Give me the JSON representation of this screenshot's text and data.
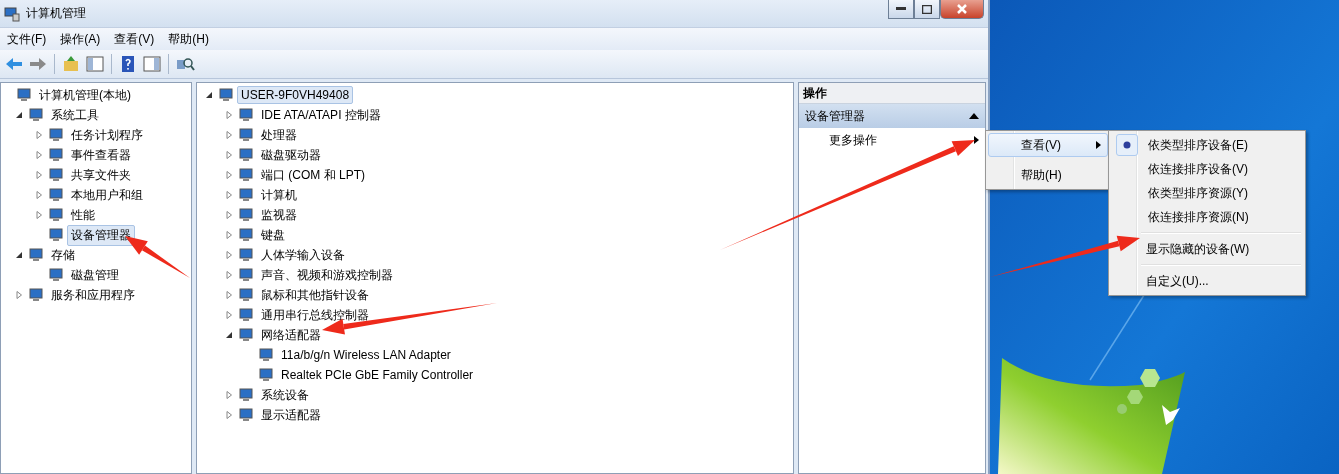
{
  "window": {
    "title": "计算机管理"
  },
  "menu_bar": [
    "文件(F)",
    "操作(A)",
    "查看(V)",
    "帮助(H)"
  ],
  "console_tree": [
    {
      "label": "计算机管理(本地)",
      "selected": false,
      "children": [
        {
          "label": "系统工具",
          "expanded": true,
          "selected": false,
          "children": [
            {
              "label": "任务计划程序",
              "expanded": false,
              "selected": false
            },
            {
              "label": "事件查看器",
              "expanded": false,
              "selected": false
            },
            {
              "label": "共享文件夹",
              "expanded": false,
              "selected": false
            },
            {
              "label": "本地用户和组",
              "expanded": false,
              "selected": false
            },
            {
              "label": "性能",
              "expanded": false,
              "selected": false
            },
            {
              "label": "设备管理器",
              "selected": true
            }
          ]
        },
        {
          "label": "存储",
          "expanded": true,
          "selected": false,
          "children": [
            {
              "label": "磁盘管理",
              "selected": false
            }
          ]
        },
        {
          "label": "服务和应用程序",
          "expanded": false,
          "selected": false
        }
      ]
    }
  ],
  "device_tree": [
    {
      "label": "USER-9F0VH49408",
      "expanded": true,
      "selected": true,
      "children": [
        {
          "label": "IDE ATA/ATAPI 控制器",
          "expanded": false,
          "selected": false
        },
        {
          "label": "处理器",
          "expanded": false,
          "selected": false
        },
        {
          "label": "磁盘驱动器",
          "expanded": false,
          "selected": false
        },
        {
          "label": "端口 (COM 和 LPT)",
          "expanded": false,
          "selected": false
        },
        {
          "label": "计算机",
          "expanded": false,
          "selected": false
        },
        {
          "label": "监视器",
          "expanded": false,
          "selected": false
        },
        {
          "label": "键盘",
          "expanded": false,
          "selected": false
        },
        {
          "label": "人体学输入设备",
          "expanded": false,
          "selected": false
        },
        {
          "label": "声音、视频和游戏控制器",
          "expanded": false,
          "selected": false
        },
        {
          "label": "鼠标和其他指针设备",
          "expanded": false,
          "selected": false
        },
        {
          "label": "通用串行总线控制器",
          "expanded": false,
          "selected": false
        },
        {
          "label": "网络适配器",
          "expanded": true,
          "selected": false,
          "children": [
            {
              "label": "11a/b/g/n Wireless LAN Adapter",
              "selected": false
            },
            {
              "label": "Realtek PCIe GbE Family Controller",
              "selected": false
            }
          ]
        },
        {
          "label": "系统设备",
          "expanded": false,
          "selected": false
        },
        {
          "label": "显示适配器",
          "expanded": false,
          "selected": false
        }
      ]
    }
  ],
  "actions_pane": {
    "title": "操作",
    "section": {
      "title": "设备管理器",
      "expanded": true
    },
    "items": [
      "更多操作"
    ]
  },
  "context_menu": [
    {
      "label": "查看(V)",
      "selected": true
    },
    {
      "label": "帮助(H)",
      "selected": false
    }
  ],
  "submenu": [
    {
      "kind": "radio",
      "label": "依类型排序设备(E)",
      "checked": true
    },
    {
      "kind": "radio",
      "label": "依连接排序设备(V)",
      "checked": false
    },
    {
      "kind": "radio",
      "label": "依类型排序资源(Y)",
      "checked": false
    },
    {
      "kind": "radio",
      "label": "依连接排序资源(N)",
      "checked": false
    },
    {
      "kind": "separator"
    },
    {
      "kind": "command",
      "label": "显示隐藏的设备(W)"
    },
    {
      "kind": "separator"
    },
    {
      "kind": "command",
      "label": "自定义(U)..."
    }
  ]
}
